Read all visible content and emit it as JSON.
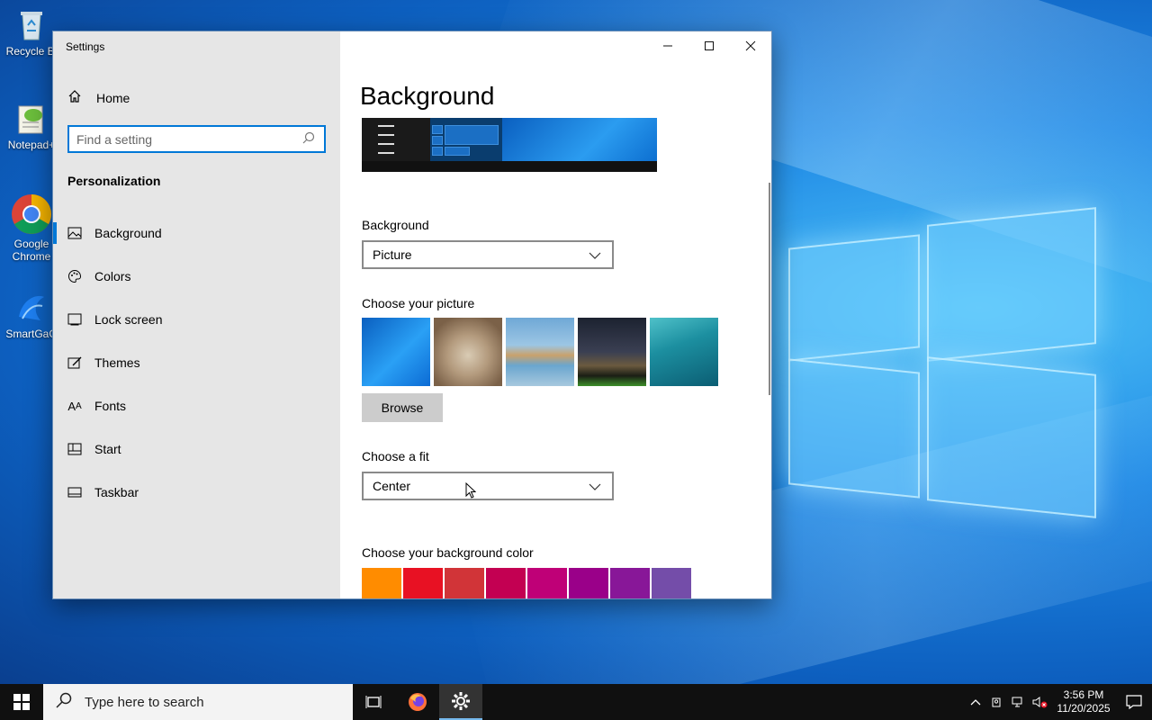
{
  "desktop": {
    "icons": [
      {
        "label": "Recycle Bi"
      },
      {
        "label": "Notepad+"
      },
      {
        "label": "Google Chrome"
      },
      {
        "label": "SmartGaG"
      }
    ]
  },
  "window": {
    "title": "Settings",
    "controls": {
      "minimize": "—",
      "maximize": "☐",
      "close": "✕"
    }
  },
  "sidebar": {
    "home_label": "Home",
    "search_placeholder": "Find a setting",
    "search_value": "",
    "category": "Personalization",
    "items": [
      {
        "label": "Background",
        "icon": "picture-icon",
        "active": true
      },
      {
        "label": "Colors",
        "icon": "palette-icon",
        "active": false
      },
      {
        "label": "Lock screen",
        "icon": "lock-screen-icon",
        "active": false
      },
      {
        "label": "Themes",
        "icon": "brush-icon",
        "active": false
      },
      {
        "label": "Fonts",
        "icon": "font-icon",
        "active": false
      },
      {
        "label": "Start",
        "icon": "start-icon",
        "active": false
      },
      {
        "label": "Taskbar",
        "icon": "taskbar-icon",
        "active": false
      }
    ]
  },
  "main": {
    "title": "Background",
    "background_label": "Background",
    "background_value": "Picture",
    "choose_picture_label": "Choose your picture",
    "browse_label": "Browse",
    "fit_label": "Choose a fit",
    "fit_value": "Center",
    "color_label": "Choose your background color",
    "swatches": [
      "#ff8c00",
      "#e81123",
      "#d13438",
      "#c30052",
      "#bf0077",
      "#9a0089",
      "#881798",
      "#744da9"
    ]
  },
  "taskbar": {
    "search_placeholder": "Type here to search",
    "time": "3:56 PM",
    "date": "11/20/2025"
  },
  "colors": {
    "accent": "#0078d7",
    "sidebar_bg": "#e6e6e6",
    "taskbar_bg": "#101010"
  }
}
